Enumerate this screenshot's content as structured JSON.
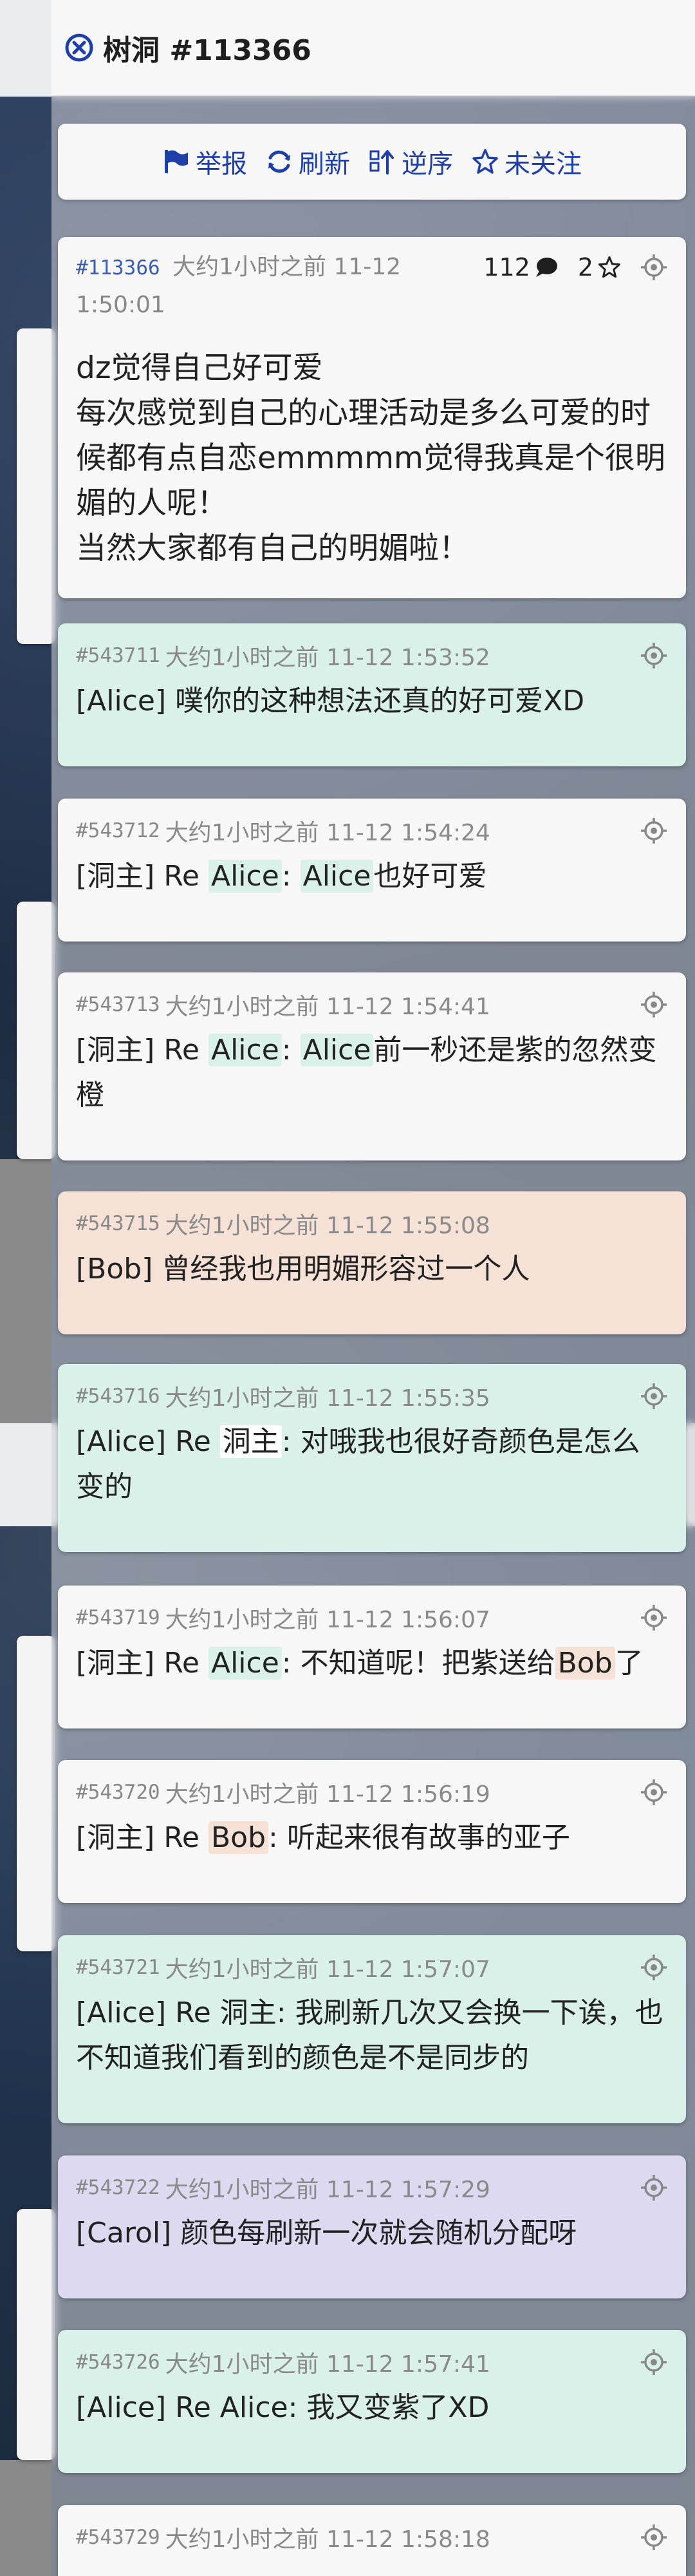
{
  "header": {
    "title": "树洞 #113366"
  },
  "toolbar": {
    "report": "举报",
    "refresh": "刷新",
    "reverse": "逆序",
    "unfollow": "未关注"
  },
  "main_post": {
    "pid": "#113366",
    "time": "大约1小时之前 11-12 1:50:01",
    "reply_count": "112",
    "star_count": "2",
    "lines": [
      "dz觉得自己好可爱",
      "每次感觉到自己的心理活动是多么可爱的时候都有点自恋emmmmm觉得我真是个很明媚的人呢！",
      "当然大家都有自己的明媚啦！"
    ]
  },
  "colors": {
    "alice": "#d9f1e9",
    "bob": "#f5e1d6",
    "carol": "#dcd9f0",
    "host": "#f7f7f8",
    "accent": "#1f3fa8"
  },
  "replies": [
    {
      "pid": "#543711",
      "time": "大约1小时之前 11-12 1:53:52",
      "speaker": "Alice",
      "parts": [
        {
          "text": "[Alice] 噗你的这种想法还真的好可爱XD"
        }
      ]
    },
    {
      "pid": "#543712",
      "time": "大约1小时之前 11-12 1:54:24",
      "speaker": "host",
      "parts": [
        {
          "text": "[洞主] Re "
        },
        {
          "text": "Alice",
          "chip": "alice"
        },
        {
          "text": ": "
        },
        {
          "text": "Alice",
          "chip": "alice"
        },
        {
          "text": "也好可爱"
        }
      ]
    },
    {
      "pid": "#543713",
      "time": "大约1小时之前 11-12 1:54:41",
      "speaker": "host",
      "parts": [
        {
          "text": "[洞主] Re "
        },
        {
          "text": "Alice",
          "chip": "alice"
        },
        {
          "text": ": "
        },
        {
          "text": "Alice",
          "chip": "alice"
        },
        {
          "text": "前一秒还是紫的忽然变橙"
        }
      ]
    },
    {
      "pid": "#543715",
      "time": "大约1小时之前 11-12 1:55:08",
      "speaker": "Bob",
      "no_locate": true,
      "parts": [
        {
          "text": "[Bob] 曾经我也用明媚形容过一个人"
        }
      ]
    },
    {
      "pid": "#543716",
      "time": "大约1小时之前 11-12 1:55:35",
      "speaker": "Alice",
      "parts": [
        {
          "text": "[Alice] Re "
        },
        {
          "text": "洞主",
          "chip": "host"
        },
        {
          "text": ": 对哦我也很好奇颜色是怎么变的"
        }
      ]
    },
    {
      "pid": "#543719",
      "time": "大约1小时之前 11-12 1:56:07",
      "speaker": "host",
      "parts": [
        {
          "text": "[洞主] Re "
        },
        {
          "text": "Alice",
          "chip": "alice"
        },
        {
          "text": ": 不知道呢！把紫送给"
        },
        {
          "text": "Bob",
          "chip": "bob"
        },
        {
          "text": "了"
        }
      ]
    },
    {
      "pid": "#543720",
      "time": "大约1小时之前 11-12 1:56:19",
      "speaker": "host",
      "parts": [
        {
          "text": "[洞主] Re "
        },
        {
          "text": "Bob",
          "chip": "bob"
        },
        {
          "text": ": 听起来很有故事的亚子"
        }
      ]
    },
    {
      "pid": "#543721",
      "time": "大约1小时之前 11-12 1:57:07",
      "speaker": "Alice",
      "parts": [
        {
          "text": "[Alice] Re 洞主: 我刷新几次又会换一下诶，也不知道我们看到的颜色是不是同步的"
        }
      ]
    },
    {
      "pid": "#543722",
      "time": "大约1小时之前 11-12 1:57:29",
      "speaker": "Carol",
      "parts": [
        {
          "text": "[Carol] 颜色每刷新一次就会随机分配呀"
        }
      ]
    },
    {
      "pid": "#543726",
      "time": "大约1小时之前 11-12 1:57:41",
      "speaker": "Alice",
      "parts": [
        {
          "text": "[Alice] Re Alice: 我又变紫了XD"
        }
      ]
    },
    {
      "pid": "#543729",
      "time": "大约1小时之前 11-12 1:58:18",
      "speaker": "host",
      "parts": []
    }
  ]
}
